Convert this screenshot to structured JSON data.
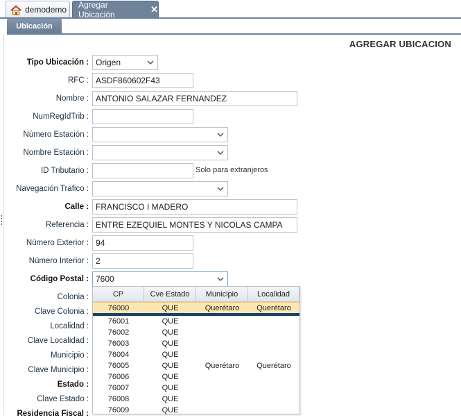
{
  "tabs": {
    "home": {
      "label": "demodemo",
      "icon": "home-icon"
    },
    "active": {
      "label": "Agregar Ubicación",
      "close": "✕"
    }
  },
  "subtab": {
    "label": "Ubicación"
  },
  "page_title": "AGREGAR UBICACION",
  "form": {
    "tipo_ubicacion": {
      "label": "Tipo Ubicación :",
      "value": "Origen"
    },
    "rfc": {
      "label": "RFC :",
      "value": "ASDF860602F43"
    },
    "nombre": {
      "label": "Nombre :",
      "value": "ANTONIO SALAZAR FERNANDEZ"
    },
    "num_reg_id_trib": {
      "label": "NumRegIdTrib :",
      "value": ""
    },
    "numero_estacion": {
      "label": "Número Estación :",
      "value": ""
    },
    "nombre_estacion": {
      "label": "Nombre Estación :",
      "value": ""
    },
    "id_tributario": {
      "label": "ID Tributario :",
      "value": "",
      "hint": "Solo para extranjeros"
    },
    "navegacion_trafico": {
      "label": "Navegación Trafico :",
      "value": ""
    },
    "calle": {
      "label": "Calle :",
      "value": "FRANCISCO I MADERO"
    },
    "referencia": {
      "label": "Referencia :",
      "value": "ENTRE EZEQUIEL MONTES Y NICOLAS CAMPA"
    },
    "numero_exterior": {
      "label": "Número Exterior :",
      "value": "94"
    },
    "numero_interior": {
      "label": "Número Interior :",
      "value": "2"
    },
    "codigo_postal": {
      "label": "Código Postal :",
      "value": "7600"
    },
    "colonia": {
      "label": "Colonia :"
    },
    "clave_colonia": {
      "label": "Clave Colonia :"
    },
    "localidad": {
      "label": "Localidad :"
    },
    "clave_localidad": {
      "label": "Clave Localidad :"
    },
    "municipio": {
      "label": "Municipio :"
    },
    "clave_municipio": {
      "label": "Clave Municipio :"
    },
    "estado": {
      "label": "Estado :"
    },
    "clave_estado": {
      "label": "Clave Estado :"
    },
    "residencia_fiscal": {
      "label": "Residencia Fiscal :"
    }
  },
  "cp_dropdown": {
    "headers": [
      "CP",
      "Cve Estado",
      "Municipio",
      "Localidad"
    ],
    "rows": [
      [
        "76000",
        "QUE",
        "Querétaro",
        "Querétaro"
      ],
      [
        "76001",
        "QUE",
        "",
        ""
      ],
      [
        "76002",
        "QUE",
        "",
        ""
      ],
      [
        "76003",
        "QUE",
        "",
        ""
      ],
      [
        "76004",
        "QUE",
        "",
        ""
      ],
      [
        "76005",
        "QUE",
        "Querétaro",
        "Querétaro"
      ],
      [
        "76006",
        "QUE",
        "",
        ""
      ],
      [
        "76007",
        "QUE",
        "",
        ""
      ],
      [
        "76008",
        "QUE",
        "",
        ""
      ],
      [
        "76009",
        "QUE",
        "",
        ""
      ]
    ]
  },
  "colors": {
    "tab_active": "#6f839b",
    "selected_row": "#fce7b3",
    "separator": "#14426b"
  }
}
